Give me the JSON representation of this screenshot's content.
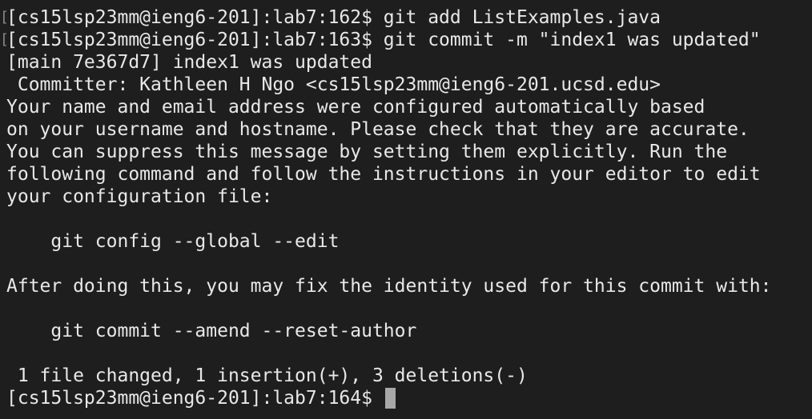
{
  "terminal": {
    "lines": [
      "[cs15lsp23mm@ieng6-201]:lab7:162$ git add ListExamples.java",
      "[cs15lsp23mm@ieng6-201]:lab7:163$ git commit -m \"index1 was updated\"",
      "[main 7e367d7] index1 was updated",
      " Committer: Kathleen H Ngo <cs15lsp23mm@ieng6-201.ucsd.edu>",
      "Your name and email address were configured automatically based",
      "on your username and hostname. Please check that they are accurate.",
      "You can suppress this message by setting them explicitly. Run the",
      "following command and follow the instructions in your editor to edit",
      "your configuration file:",
      "",
      "    git config --global --edit",
      "",
      "After doing this, you may fix the identity used for this commit with:",
      "",
      "    git commit --amend --reset-author",
      "",
      " 1 file changed, 1 insertion(+), 3 deletions(-)"
    ],
    "prompt": "[cs15lsp23mm@ieng6-201]:lab7:164$ "
  },
  "colors": {
    "background": "#1e1e1e",
    "text": "#e8e8e8",
    "cursor": "#a8a8a8"
  }
}
